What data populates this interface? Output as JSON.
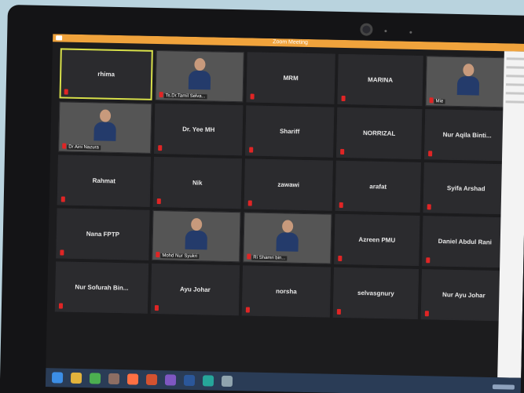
{
  "window": {
    "title": "Zoom Meeting"
  },
  "participants": [
    {
      "name": "rhima",
      "muted": true,
      "video": false,
      "active": true
    },
    {
      "name": "Ts.Dr.Tamil Selva...",
      "muted": true,
      "video": true,
      "active": false
    },
    {
      "name": "MRM",
      "muted": true,
      "video": false,
      "active": false
    },
    {
      "name": "MARINA",
      "muted": true,
      "video": false,
      "active": false
    },
    {
      "name": "Mie",
      "muted": true,
      "video": true,
      "active": false
    },
    {
      "name": "Dr Aini Nazura",
      "muted": true,
      "video": true,
      "active": false
    },
    {
      "name": "Dr. Yee MH",
      "muted": true,
      "video": false,
      "active": false
    },
    {
      "name": "Shariff",
      "muted": true,
      "video": false,
      "active": false
    },
    {
      "name": "NORRIZAL",
      "muted": true,
      "video": false,
      "active": false
    },
    {
      "name": "Nur Aqila Binti...",
      "muted": true,
      "video": false,
      "active": false
    },
    {
      "name": "Rahmat",
      "muted": true,
      "video": false,
      "active": false
    },
    {
      "name": "Nik",
      "muted": true,
      "video": false,
      "active": false
    },
    {
      "name": "zawawi",
      "muted": true,
      "video": false,
      "active": false
    },
    {
      "name": "arafat",
      "muted": true,
      "video": false,
      "active": false
    },
    {
      "name": "Syifa Arshad",
      "muted": true,
      "video": false,
      "active": false
    },
    {
      "name": "Nana FPTP",
      "muted": true,
      "video": false,
      "active": false
    },
    {
      "name": "Mohd Nur Syukri",
      "muted": true,
      "video": true,
      "active": false
    },
    {
      "name": "Ri Shamri bin...",
      "muted": true,
      "video": true,
      "active": false
    },
    {
      "name": "Azreen PMU",
      "muted": true,
      "video": false,
      "active": false
    },
    {
      "name": "Daniel Abdul Rani",
      "muted": true,
      "video": false,
      "active": false
    },
    {
      "name": "Nur Sofurah Bin...",
      "muted": true,
      "video": false,
      "active": false
    },
    {
      "name": "Ayu Johar",
      "muted": true,
      "video": false,
      "active": false
    },
    {
      "name": "norsha",
      "muted": true,
      "video": false,
      "active": false
    },
    {
      "name": "selvasgnury",
      "muted": true,
      "video": false,
      "active": false
    },
    {
      "name": "Nur Ayu Johar",
      "muted": true,
      "video": false,
      "active": false
    }
  ],
  "colors": {
    "active_speaker_border": "#d8e04a",
    "mute_icon": "#e02525",
    "titlebar": "#f0a33c",
    "tile_bg": "#2b2b2e",
    "taskbar": "#2a3c56"
  },
  "taskbar_icons": [
    "windows-start-icon",
    "folder-icon",
    "chrome-icon",
    "app-icon",
    "firefox-icon",
    "powerpoint-icon",
    "app-icon",
    "word-icon",
    "app-icon",
    "app-icon"
  ]
}
